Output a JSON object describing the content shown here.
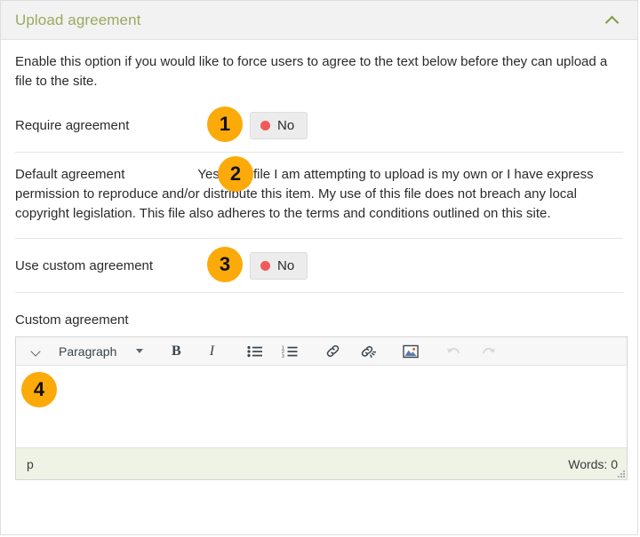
{
  "panel": {
    "title": "Upload agreement",
    "collapse_icon": "chevron-up-icon",
    "intro": "Enable this option if you would like to force users to agree to the text below before they can upload a file to the site."
  },
  "rows": {
    "require_agreement": {
      "label": "Require agreement",
      "toggle_value": "No",
      "toggle_state_color": "#ef5b5b",
      "badge": "1"
    },
    "default_agreement": {
      "label": "Default agreement",
      "text": "Yes: The file I am attempting to upload is my own or I have express permission to reproduce and/or distribute this item. My use of this file does not breach any local copyright legislation. This file also adheres to the terms and conditions outlined on this site.",
      "badge": "2"
    },
    "use_custom_agreement": {
      "label": "Use custom agreement",
      "toggle_value": "No",
      "toggle_state_color": "#ef5b5b",
      "badge": "3"
    },
    "custom_agreement": {
      "label": "Custom agreement",
      "badge": "4",
      "content": ""
    }
  },
  "editor": {
    "style_select": "Paragraph",
    "toolbar": [
      {
        "name": "block-style-toggle-icon",
        "glyph": "chevron-down-icon"
      },
      {
        "name": "style-select",
        "glyph": "Paragraph"
      },
      {
        "name": "bold-button",
        "glyph": "B"
      },
      {
        "name": "italic-button",
        "glyph": "I"
      },
      {
        "name": "bullet-list-button",
        "glyph": "bullet-list-icon"
      },
      {
        "name": "numbered-list-button",
        "glyph": "numbered-list-icon"
      },
      {
        "name": "link-button",
        "glyph": "link-icon"
      },
      {
        "name": "unlink-button",
        "glyph": "unlink-icon"
      },
      {
        "name": "image-button",
        "glyph": "image-icon"
      },
      {
        "name": "undo-button",
        "glyph": "undo-icon"
      },
      {
        "name": "redo-button",
        "glyph": "redo-icon"
      }
    ],
    "statusbar": {
      "path": "p",
      "word_count": "Words: 0"
    }
  },
  "colors": {
    "header_title": "#9aaa5f",
    "badge_bg": "#fcaa09",
    "badge_text": "#111111",
    "toggle_off_dot": "#ef5b5b",
    "statusbar_bg": "#eef3e6"
  }
}
